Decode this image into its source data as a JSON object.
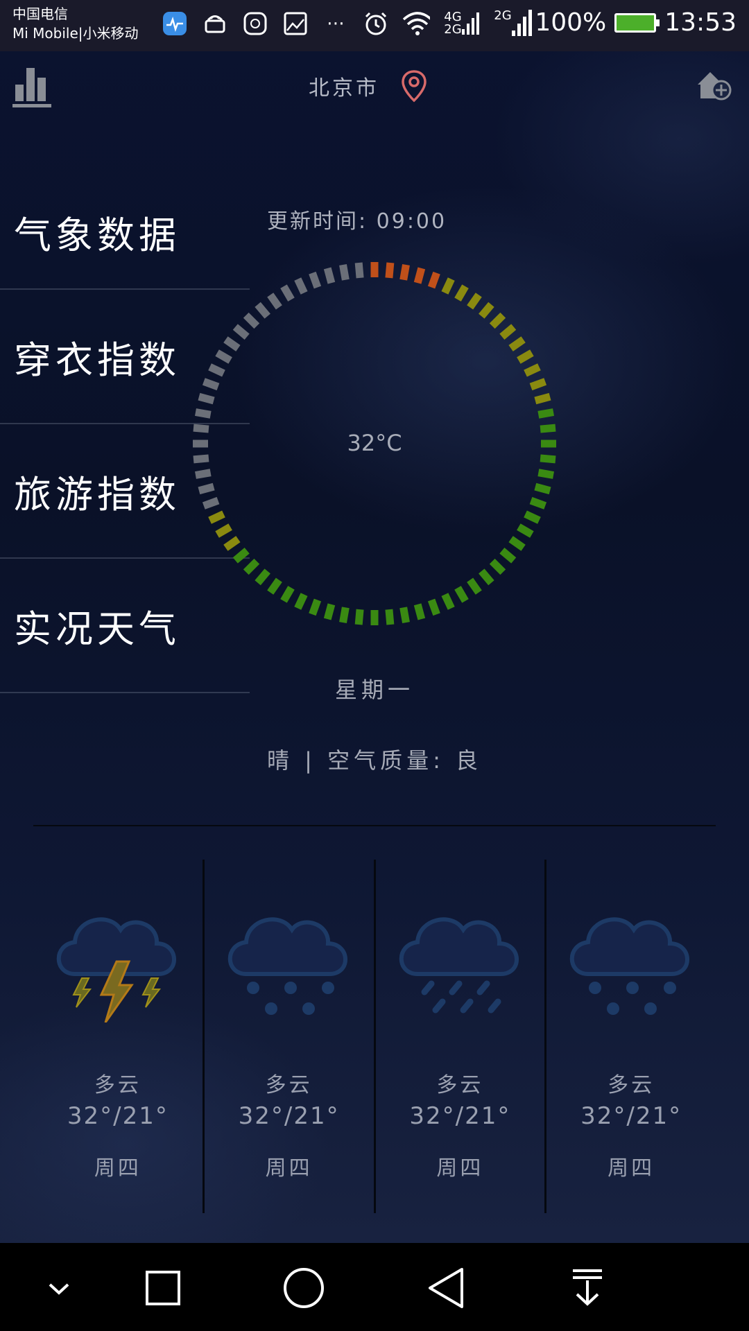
{
  "status_bar": {
    "carrier_line1": "中国电信",
    "carrier_line2": "Mi Mobile|小米移动",
    "net1": "4G",
    "net2": "2G",
    "net3": "2G",
    "battery": "100%",
    "time": "13:53",
    "icons": [
      "health-app-icon",
      "android-icon",
      "huawei-icon",
      "image-icon",
      "more-icon",
      "alarm-icon",
      "wifi-icon",
      "signal-icon",
      "battery-icon"
    ]
  },
  "header": {
    "city": "北京市"
  },
  "menu": {
    "items": [
      {
        "label": "气象数据"
      },
      {
        "label": "穿衣指数"
      },
      {
        "label": "旅游指数"
      },
      {
        "label": "实况天气"
      }
    ]
  },
  "current": {
    "update_time": "更新时间: 09:00",
    "temperature": "32°C",
    "weekday": "星期一",
    "condition": "晴 | 空气质量: 良"
  },
  "forecast": [
    {
      "icon": "thunderstorm-icon",
      "condition": "多云",
      "temp": "32°/21°",
      "day": "周四"
    },
    {
      "icon": "snow-icon",
      "condition": "多云",
      "temp": "32°/21°",
      "day": "周四"
    },
    {
      "icon": "rain-icon",
      "condition": "多云",
      "temp": "32°/21°",
      "day": "周四"
    },
    {
      "icon": "snow-icon",
      "condition": "多云",
      "temp": "32°/21°",
      "day": "周四"
    }
  ],
  "colors": {
    "dial_cold": "#6b6f78",
    "dial_hot": "#c0501a",
    "dial_warm": "#8a8a10",
    "dial_green": "#3a8a12",
    "battery_fill": "#4caf2a"
  }
}
